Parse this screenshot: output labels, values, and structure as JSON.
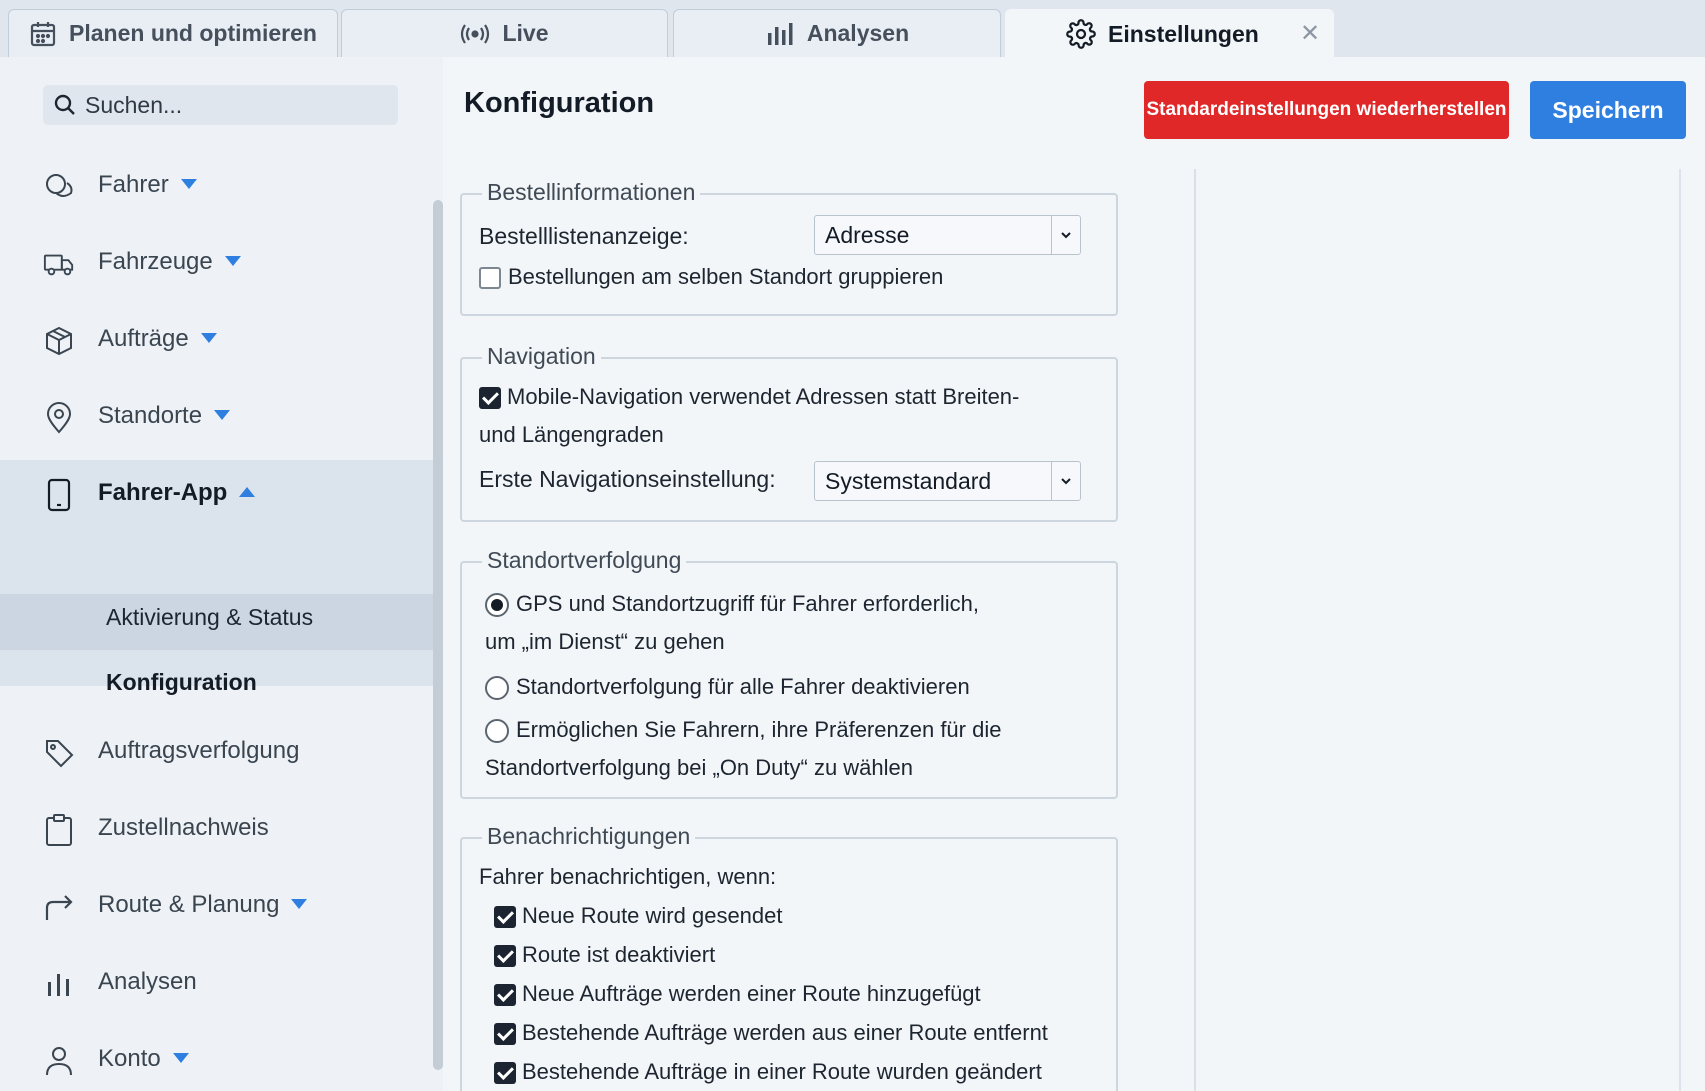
{
  "tabs": [
    {
      "label": "Planen und optimieren",
      "icon": "calendar-icon"
    },
    {
      "label": "Live",
      "icon": "broadcast-icon"
    },
    {
      "label": "Analysen",
      "icon": "bar-chart-icon"
    },
    {
      "label": "Einstellungen",
      "icon": "gear-icon",
      "active": true,
      "close": "✕"
    }
  ],
  "sidebar": {
    "search_placeholder": "Suchen...",
    "items": [
      {
        "label": "Fahrer",
        "icon": "drivers-icon"
      },
      {
        "label": "Fahrzeuge",
        "icon": "truck-icon"
      },
      {
        "label": "Aufträge",
        "icon": "box-icon"
      },
      {
        "label": "Standorte",
        "icon": "location-pin-icon"
      },
      {
        "label": "Fahrer-App",
        "icon": "phone-icon"
      },
      {
        "label": "Auftragsverfolgung",
        "icon": "tag-icon"
      },
      {
        "label": "Zustellnachweis",
        "icon": "clipboard-icon"
      },
      {
        "label": "Route & Planung",
        "icon": "route-arrow-icon"
      },
      {
        "label": "Analysen",
        "icon": "bar-chart-icon"
      },
      {
        "label": "Konto",
        "icon": "user-icon"
      }
    ],
    "subitems": [
      "Aktivierung & Status",
      "Konfiguration"
    ]
  },
  "main": {
    "title": "Konfiguration",
    "reset_label": "Standardeinstellungen wiederherstellen",
    "save_label": "Speichern",
    "order_info": {
      "legend": "Bestellinformationen",
      "list_label": "Bestelllistenanzeige:",
      "list_value": "Adresse",
      "group_label": "Bestellungen am selben Standort gruppieren"
    },
    "navigation": {
      "legend": "Navigation",
      "mobile_line1": "Mobile-Navigation verwendet Adressen statt Breiten-",
      "mobile_line2": "und Längengraden",
      "first_label": "Erste Navigationseinstellung:",
      "first_value": "Systemstandard"
    },
    "tracking": {
      "legend": "Standortverfolgung",
      "opt1_line1": "GPS und Standortzugriff für Fahrer erforderlich,",
      "opt1_line2": "um „im Dienst“ zu gehen",
      "opt2": "Standortverfolgung für alle Fahrer deaktivieren",
      "opt3_line1": "Ermöglichen Sie Fahrern, ihre Präferenzen für die",
      "opt3_line2": "Standortverfolgung bei „On Duty“ zu wählen"
    },
    "notifications": {
      "legend": "Benachrichtigungen",
      "intro": "Fahrer benachrichtigen, wenn:",
      "items": [
        "Neue Route wird gesendet",
        "Route ist deaktiviert",
        "Neue Aufträge werden einer Route hinzugefügt",
        "Bestehende Aufträge werden aus einer Route entfernt",
        "Bestehende Aufträge in einer Route wurden geändert"
      ]
    }
  },
  "colors": {
    "accent": "#2f7fe0",
    "danger": "#e02828",
    "dark": "#131c26"
  }
}
